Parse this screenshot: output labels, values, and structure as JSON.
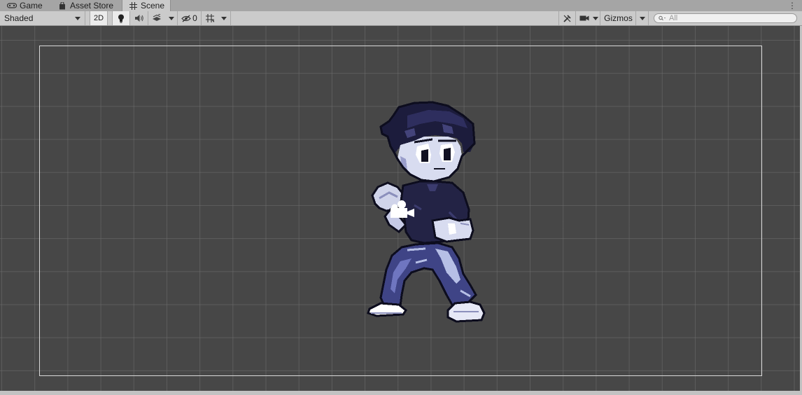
{
  "tabs": [
    {
      "label": "Game",
      "icon": "gamepad-icon",
      "active": false
    },
    {
      "label": "Asset Store",
      "icon": "shopping-bag-icon",
      "active": false
    },
    {
      "label": "Scene",
      "icon": "grid-icon",
      "active": true
    }
  ],
  "toolbar": {
    "draw_mode": "Shaded",
    "mode_2d": "2D",
    "hidden_count": "0",
    "gizmos_label": "Gizmos",
    "search_placeholder": "All"
  },
  "colors": {
    "viewport_bg": "#474747",
    "grid_line": "#6e6e6e",
    "camera_frame": "#d9d9d9",
    "toolbar_bg": "#cbcbcb",
    "tabbar_bg": "#a5a5a5"
  }
}
